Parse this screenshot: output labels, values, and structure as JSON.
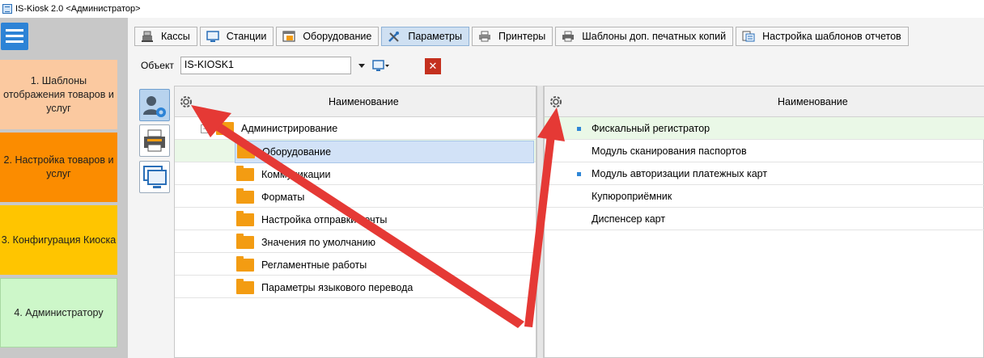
{
  "window": {
    "title": "IS-Kiosk 2.0 <Администратор>"
  },
  "left_nav": {
    "items": [
      {
        "label_lines": [
          "1. Шаблоны",
          "отображения товаров и",
          "услуг"
        ],
        "color": "#fbc9a0"
      },
      {
        "label_lines": [
          "2. Настройка товаров и",
          "услуг"
        ],
        "color": "#fb8c00"
      },
      {
        "label_lines": [
          "3. Конфигурация Киоска"
        ],
        "color": "#ffc500"
      },
      {
        "label_lines": [
          "4. Администратору"
        ],
        "color": "#cdf7c9"
      }
    ]
  },
  "tabs": [
    {
      "label": "Кассы",
      "icon": "cash-register-icon",
      "active": false
    },
    {
      "label": "Станции",
      "icon": "monitor-icon",
      "active": false
    },
    {
      "label": "Оборудование",
      "icon": "window-icon",
      "active": false
    },
    {
      "label": "Параметры",
      "icon": "tools-icon",
      "active": true
    },
    {
      "label": "Принтеры",
      "icon": "printer-icon",
      "active": false
    },
    {
      "label": "Шаблоны доп. печатных копий",
      "icon": "printer-copy-icon",
      "active": false
    },
    {
      "label": "Настройка шаблонов отчетов",
      "icon": "report-template-icon",
      "active": false
    }
  ],
  "object": {
    "label": "Объект",
    "value": "IS-KIOSK1"
  },
  "left_grid": {
    "column_title": "Наименование",
    "root": "Администрирование",
    "children": [
      "Оборудование",
      "Коммуникации",
      "Форматы",
      "Настройка отправки почты",
      "Значения по умолчанию",
      "Регламентные работы",
      "Параметры языкового перевода"
    ],
    "selected_index": 0
  },
  "right_grid": {
    "column_title": "Наименование",
    "rows": [
      {
        "label": "Фискальный регистратор",
        "marked": true,
        "highlight": true
      },
      {
        "label": "Модуль сканирования паспортов",
        "marked": false,
        "highlight": false
      },
      {
        "label": "Модуль авторизации платежных карт",
        "marked": true,
        "highlight": false
      },
      {
        "label": "Купюроприёмник",
        "marked": false,
        "highlight": false
      },
      {
        "label": "Диспенсер карт",
        "marked": false,
        "highlight": false
      }
    ]
  },
  "annotation_color": "#e53935",
  "accent": "#2d83d6"
}
